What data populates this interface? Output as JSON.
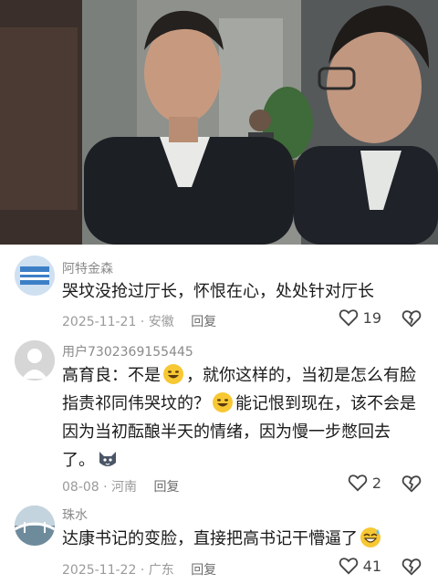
{
  "comments": [
    {
      "username": "阿特金森",
      "text": "哭坟没抢过厅长，怀恨在心，处处针对厅长",
      "date": "2025-11-21",
      "location": "安徽",
      "reply_label": "回复",
      "likes": "19"
    },
    {
      "username": "用户7302369155445",
      "text_1": "高育良：不是",
      "text_2": "，就你这样的，当初是怎么有脸",
      "text_3": "指责祁同伟哭坟的？",
      "text_4": "能记恨到现在，该不会是",
      "text_5": "因为当初酝酿半天的情绪，因为慢一步憋回去",
      "text_6": "了。",
      "date": "08-08",
      "location": "河南",
      "reply_label": "回复",
      "likes": "2"
    },
    {
      "username": "珠水",
      "text": "达康书记的变脸，直接把高书记干懵逼了",
      "date": "2025-11-22",
      "location": "广东",
      "reply_label": "回复",
      "likes": "41"
    }
  ],
  "icons": {
    "like": "heart-outline-icon",
    "dislike": "broken-heart-icon",
    "emoji_smile": "grinning-emoji-icon",
    "emoji_sweat": "sweat-smile-emoji-icon",
    "sticker": "dog-sticker-icon"
  },
  "colors": {
    "text": "#1a1a1a",
    "meta": "#9a9a9a",
    "username": "#8a8a8a"
  }
}
